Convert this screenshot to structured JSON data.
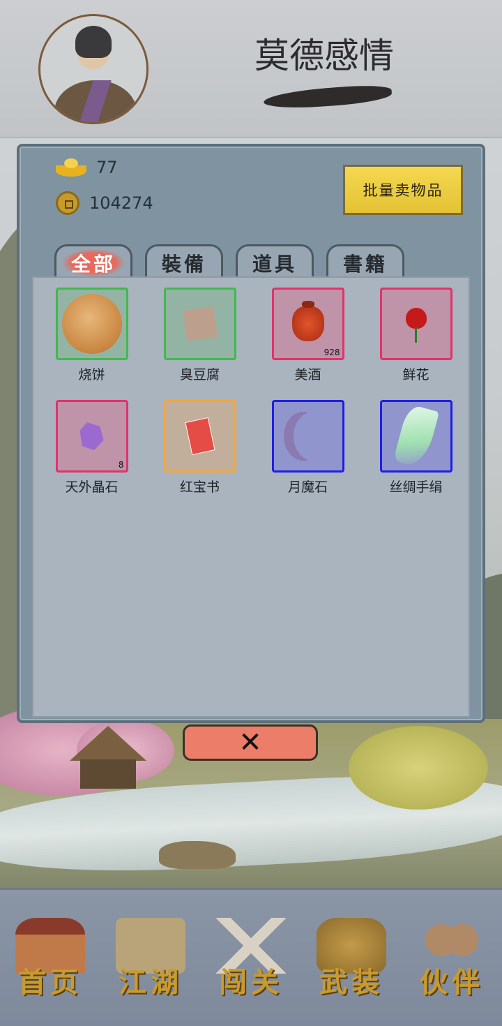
{
  "header": {
    "player_name": "莫德感情"
  },
  "currency": {
    "gold_ingots": "77",
    "coins": "104274"
  },
  "sell_button_label": "批量卖物品",
  "tabs": [
    {
      "label": "全部",
      "active": true
    },
    {
      "label": "裝備",
      "active": false
    },
    {
      "label": "道具",
      "active": false
    },
    {
      "label": "書籍",
      "active": false
    }
  ],
  "items": [
    {
      "name": "烧饼",
      "quantity": "",
      "rarity_color": "green",
      "icon": "flatbread-icon"
    },
    {
      "name": "臭豆腐",
      "quantity": "",
      "rarity_color": "green",
      "icon": "tofu-icon"
    },
    {
      "name": "美酒",
      "quantity": "928",
      "rarity_color": "red",
      "icon": "wine-jar-icon"
    },
    {
      "name": "鲜花",
      "quantity": "",
      "rarity_color": "red",
      "icon": "rose-icon"
    },
    {
      "name": "天外晶石",
      "quantity": "8",
      "rarity_color": "red",
      "icon": "crystal-icon"
    },
    {
      "name": "红宝书",
      "quantity": "",
      "rarity_color": "orange",
      "icon": "red-book-icon"
    },
    {
      "name": "月魔石",
      "quantity": "",
      "rarity_color": "blue",
      "icon": "moon-stone-icon"
    },
    {
      "name": "丝绸手绢",
      "quantity": "",
      "rarity_color": "blue",
      "icon": "silk-handkerchief-icon"
    }
  ],
  "bottom_nav": [
    {
      "label": "首页",
      "icon": "house-icon"
    },
    {
      "label": "江湖",
      "icon": "scroll-icon"
    },
    {
      "label": "闯关",
      "icon": "crossed-swords-icon"
    },
    {
      "label": "武装",
      "icon": "armor-icon"
    },
    {
      "label": "伙伴",
      "icon": "companions-icon"
    }
  ],
  "colors": {
    "rarity_green": "#3fba4d",
    "rarity_red": "#e2326a",
    "rarity_orange": "#f3a73c",
    "rarity_blue": "#1f1ee6",
    "sell_button": "#f4d850",
    "close_button": "#ec7d69",
    "nav_label": "#c99a2e"
  }
}
